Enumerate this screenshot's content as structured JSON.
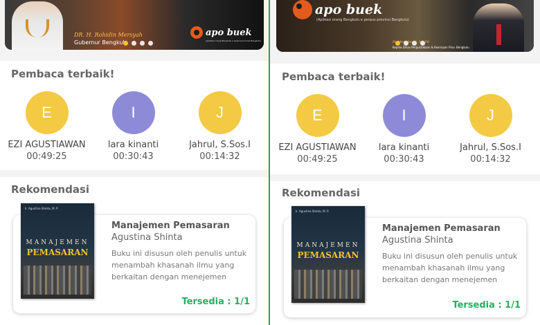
{
  "brand": {
    "name": "apo buek",
    "tagline": "(Aplikasi orang Bengkulu e perpus provinsi Bengkulu)"
  },
  "banner_left": {
    "person_name": "DR. H. Rohidin Mersyah",
    "person_role": "Gubernur Bengkulu"
  },
  "banner_right": {
    "person_name": "H. Meri Sasdi, M. Pd",
    "person_role": "Kepala Dinas Perpustakaan & Kearsipan Prov. Bengkulu"
  },
  "best_readers": {
    "title": "Pembaca terbaik!",
    "items": [
      {
        "initial": "E",
        "name": "EZI AGUSTIAWAN",
        "time": "00:49:25",
        "color": "#f4c944"
      },
      {
        "initial": "I",
        "name": "lara kinanti",
        "time": "00:30:43",
        "color": "#8d8bd8"
      },
      {
        "initial": "J",
        "name": "Jahrul, S.Sos.I",
        "time": "00:14:32",
        "color": "#f4c944"
      }
    ]
  },
  "recommendation": {
    "title": "Rekomendasi",
    "book": {
      "title": "Manajemen Pemasaran",
      "author": "Agustina Shinta",
      "description": "Buku ini disusun oleh penulis untuk menambah khasanah ilmu yang berkaitan dengan menejemen pemasaran",
      "availability": "Tersedia : 1/1",
      "cover_title_line1": "MANAJEMEN",
      "cover_title_line2": "PEMASARAN",
      "cover_author": "Ir. Agustina Shinta, M. P."
    }
  },
  "colors": {
    "accent_green": "#27ae60",
    "divider": "#2e9e4f",
    "yellow": "#f4c944",
    "purple": "#8d8bd8"
  }
}
